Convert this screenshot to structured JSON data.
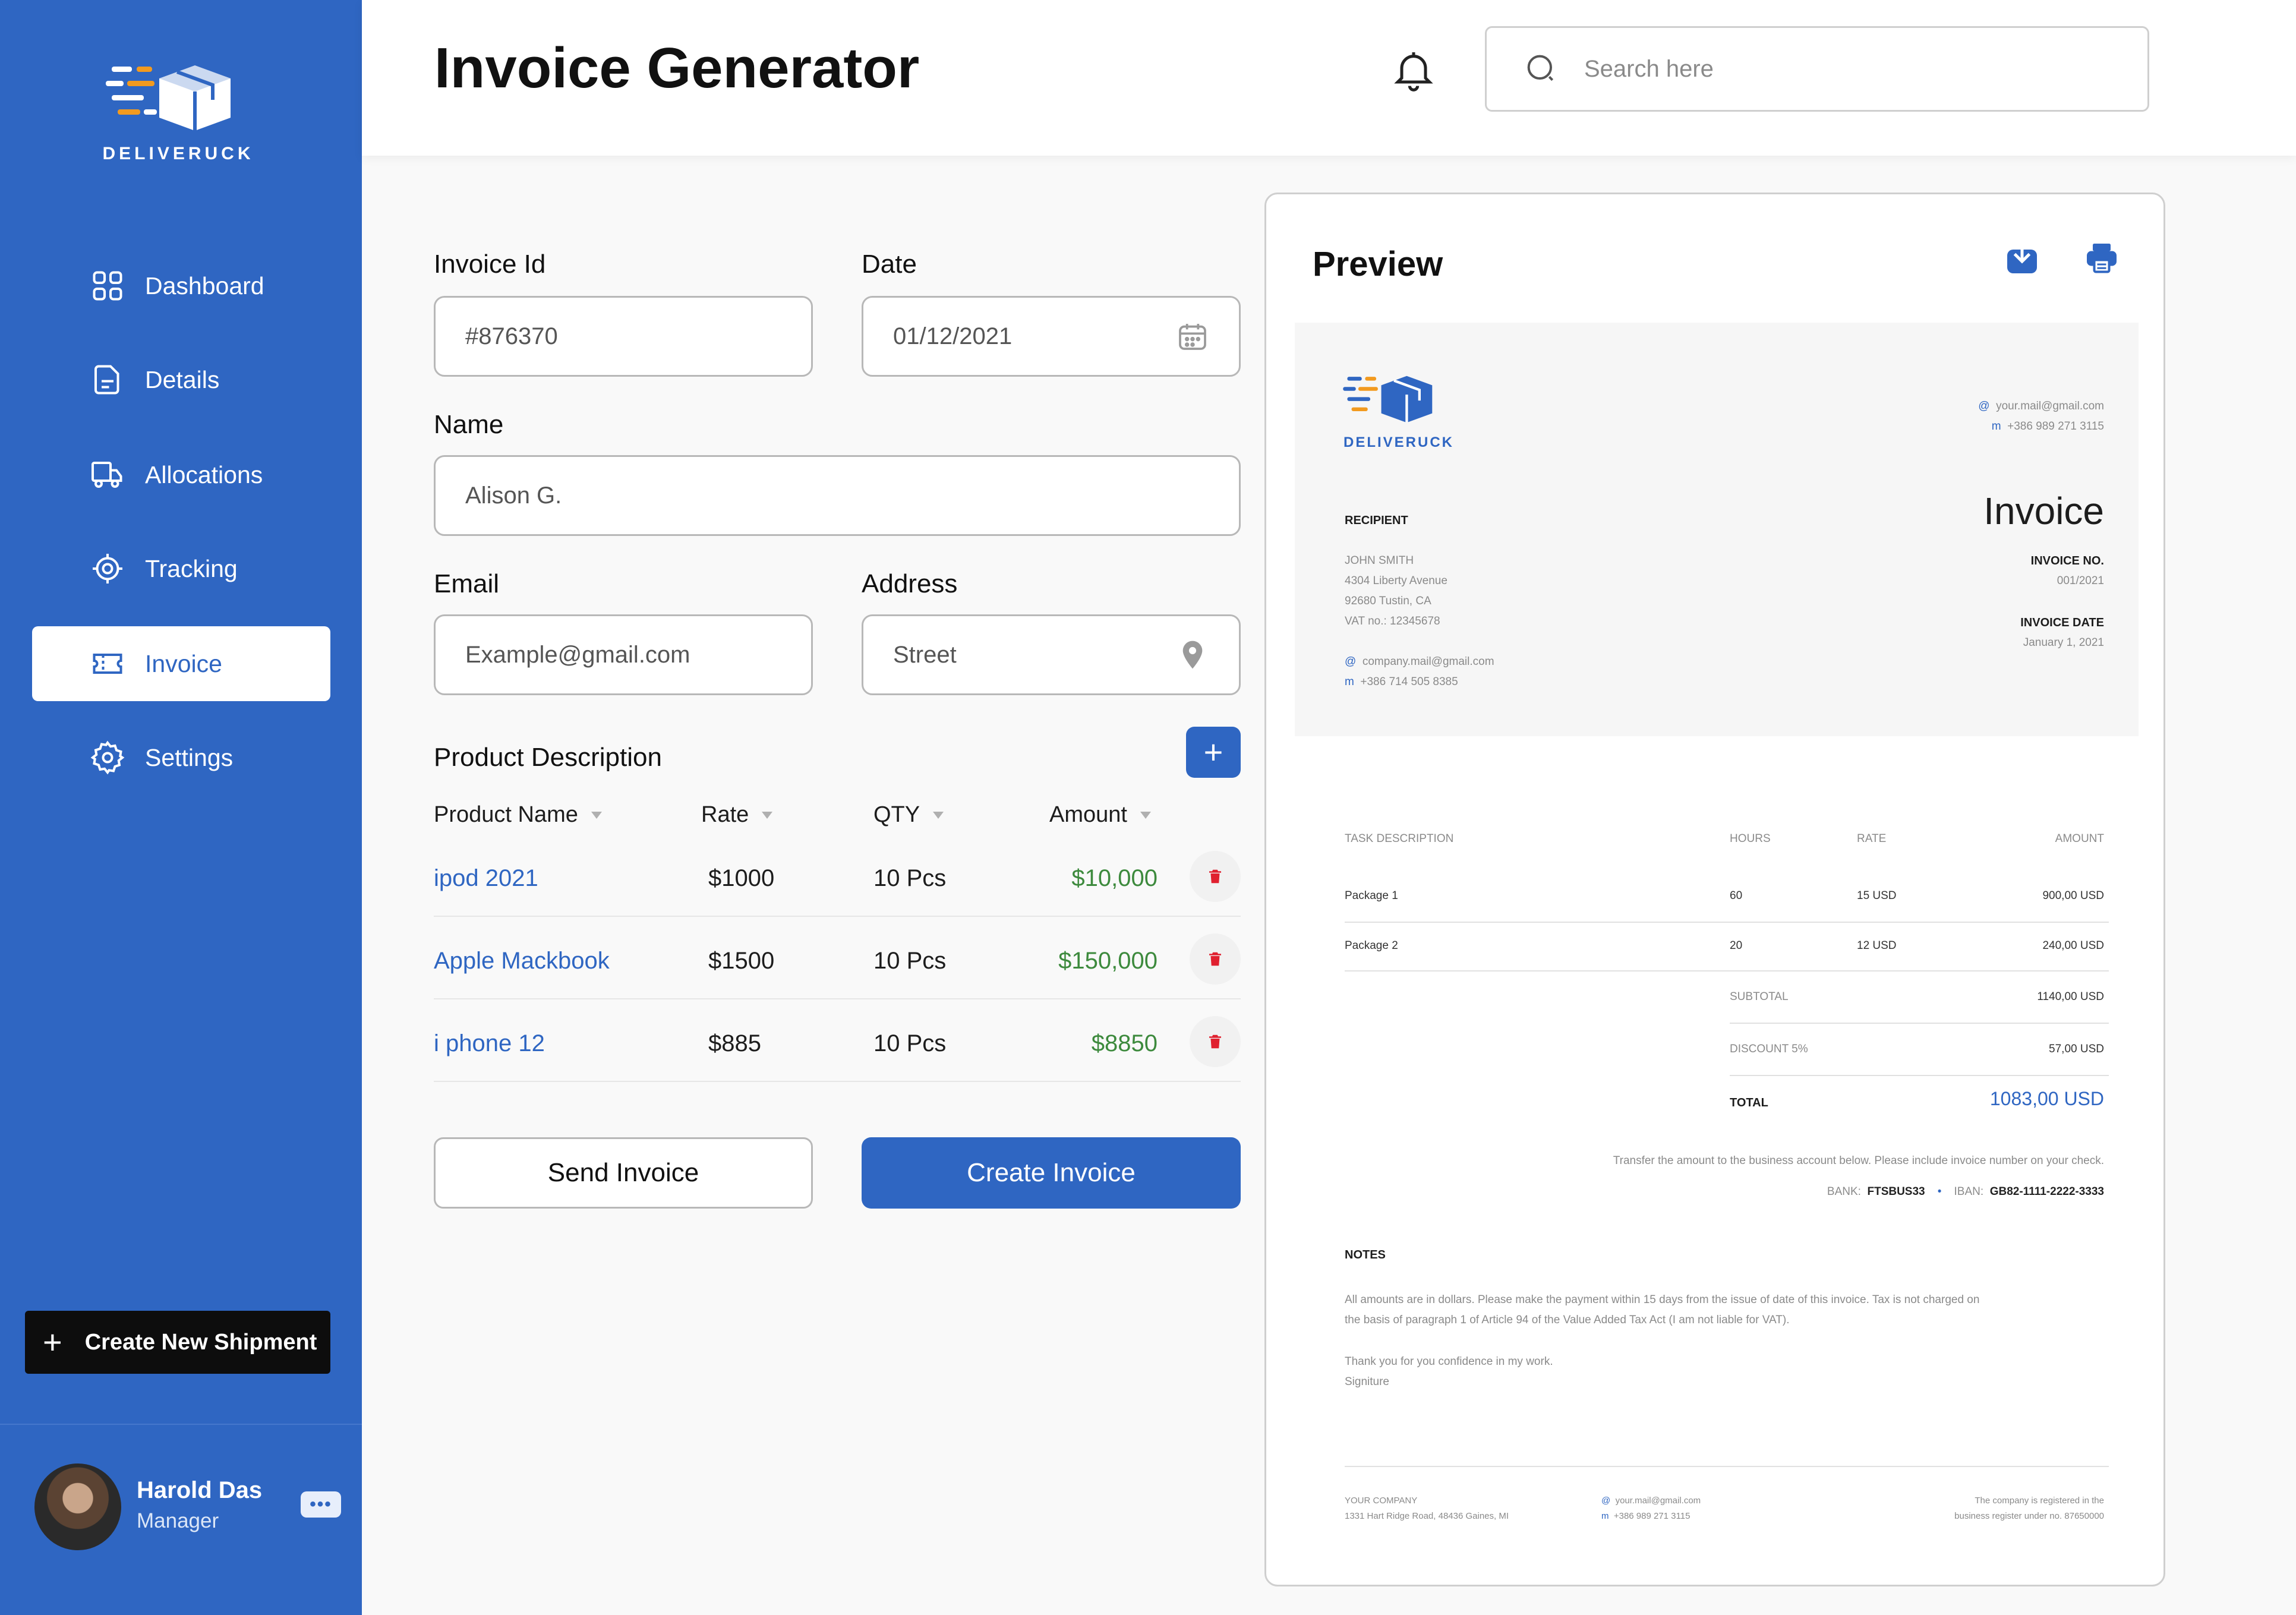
{
  "brand": {
    "name": "DELIVERUCK",
    "colors": {
      "primary": "#2f66c2",
      "accent": "#f29a1f",
      "success": "#3d8a3d",
      "danger": "#e0202f"
    }
  },
  "sidebar": {
    "items": [
      {
        "label": "Dashboard",
        "icon": "dashboard-icon"
      },
      {
        "label": "Details",
        "icon": "details-icon"
      },
      {
        "label": "Allocations",
        "icon": "truck-icon"
      },
      {
        "label": "Tracking",
        "icon": "tracking-icon"
      },
      {
        "label": "Invoice",
        "icon": "ticket-icon",
        "active": true
      },
      {
        "label": "Settings",
        "icon": "gear-icon"
      }
    ],
    "create_button": "Create New Shipment",
    "user": {
      "name": "Harold Das",
      "role": "Manager",
      "menu": "•••"
    }
  },
  "header": {
    "title": "Invoice Generator",
    "search_placeholder": "Search here"
  },
  "form": {
    "invoice_id": {
      "label": "Invoice Id",
      "value": "#876370"
    },
    "date": {
      "label": "Date",
      "value": "01/12/2021"
    },
    "name": {
      "label": "Name",
      "value": "Alison G."
    },
    "email": {
      "label": "Email",
      "value": "Example@gmail.com"
    },
    "address": {
      "label": "Address",
      "value": "Street"
    },
    "product_section": "Product Description",
    "add_label": "+",
    "columns": [
      "Product Name",
      "Rate",
      "QTY",
      "Amount"
    ],
    "products": [
      {
        "name": "ipod 2021",
        "rate": "$1000",
        "qty": "10 Pcs",
        "amount": "$10,000"
      },
      {
        "name": "Apple Mackbook",
        "rate": "$1500",
        "qty": "10 Pcs",
        "amount": "$150,000"
      },
      {
        "name": "i phone 12",
        "rate": "$885",
        "qty": "10 Pcs",
        "amount": "$8850"
      }
    ],
    "send_label": "Send Invoice",
    "create_label": "Create Invoice"
  },
  "preview": {
    "title": "Preview",
    "doc": {
      "logo_text": "DELIVERUCK",
      "contact_email": "your.mail@gmail.com",
      "contact_phone": "+386 989 271 3115",
      "recipient_label": "RECIPIENT",
      "recipient_name": "JOHN SMITH",
      "recipient_street": "4304 Liberty Avenue",
      "recipient_city": "92680 Tustin, CA",
      "recipient_vat": "VAT no.: 12345678",
      "recipient_email": "company.mail@gmail.com",
      "recipient_phone": "+386 714 505 8385",
      "heading": "Invoice",
      "invoice_no_label": "INVOICE NO.",
      "invoice_no": "001/2021",
      "invoice_date_label": "INVOICE DATE",
      "invoice_date": "January 1, 2021",
      "table_headers": [
        "TASK DESCRIPTION",
        "HOURS",
        "RATE",
        "AMOUNT"
      ],
      "rows": [
        {
          "task": "Package 1",
          "hours": "60",
          "rate": "15 USD",
          "amount": "900,00 USD"
        },
        {
          "task": "Package 2",
          "hours": "20",
          "rate": "12 USD",
          "amount": "240,00 USD"
        }
      ],
      "subtotal_label": "SUBTOTAL",
      "subtotal": "1140,00 USD",
      "discount_label": "DISCOUNT 5%",
      "discount": "57,00 USD",
      "total_label": "TOTAL",
      "total": "1083,00 USD",
      "transfer_note": "Transfer the amount to the business account below. Please include invoice number on your check.",
      "bank_label": "BANK:",
      "bank": "FTSBUS33",
      "iban_label": "IBAN:",
      "iban": "GB82-1111-2222-3333",
      "notes_label": "NOTES",
      "notes_line1": "All amounts are in dollars. Please make the payment within 15 days from the issue of date of this invoice. Tax is not charged on",
      "notes_line2": "the basis of paragraph 1 of Article 94 of the Value Added Tax Act (I am not liable for VAT).",
      "thanks": "Thank you for you confidence in my work.",
      "signature": "Signiture",
      "footer_company": "YOUR COMPANY",
      "footer_address": "1331 Hart Ridge Road, 48436 Gaines, MI",
      "footer_email": "your.mail@gmail.com",
      "footer_phone": "+386 989 271 3115",
      "footer_reg1": "The company is registered in the",
      "footer_reg2": "business register under no. 87650000"
    }
  }
}
